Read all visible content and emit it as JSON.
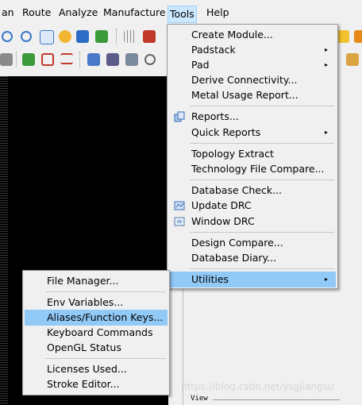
{
  "menubar": {
    "items": [
      "an",
      "Route",
      "Analyze",
      "Manufacture",
      "Tools",
      "Help"
    ]
  },
  "tools_menu": {
    "items": [
      "Create Module...",
      "Padstack",
      "Pad",
      "Derive Connectivity...",
      "Metal Usage Report...",
      "Reports...",
      "Quick Reports",
      "Topology Extract",
      "Technology File Compare...",
      "Database Check...",
      "Update DRC",
      "Window DRC",
      "Design Compare...",
      "Database Diary...",
      "Utilities"
    ]
  },
  "utilities_menu": {
    "items": [
      "File Manager...",
      "Env Variables...",
      "Aliases/Function Keys...",
      "Keyboard Commands",
      "OpenGL Status",
      "Licenses Used...",
      "Stroke Editor..."
    ]
  },
  "panel": {
    "view_label": "View",
    "watermark": "https://blog.csdn.net/ysgjiangsu"
  },
  "icons": {
    "submenu_arrow": "▸",
    "reports": "reports-icon",
    "update_drc": "update-drc-icon",
    "window_drc": "window-drc-icon"
  },
  "colors": {
    "menu_highlight": "#91c9f7",
    "menubar_active": "#cce8ff",
    "canvas": "#000000"
  }
}
